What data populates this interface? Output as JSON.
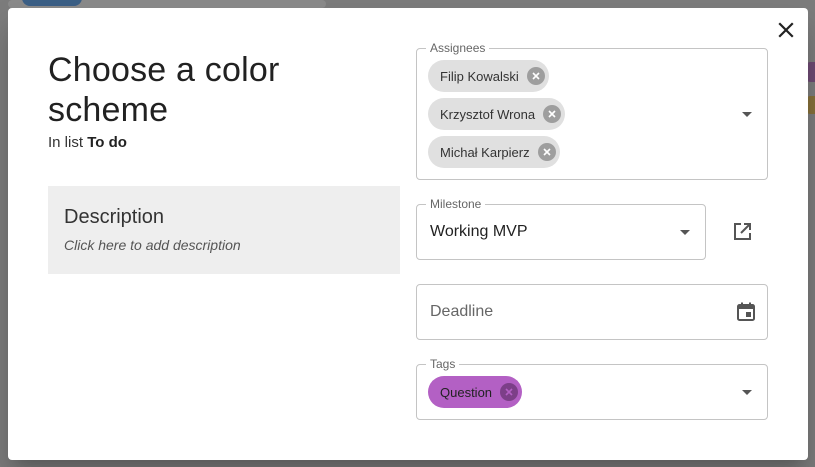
{
  "dialog": {
    "title": "Choose a color scheme",
    "subtitle_prefix": "In list",
    "list_name": "To do",
    "description": {
      "heading": "Description",
      "hint": "Click here to add description"
    },
    "assignees": {
      "label": "Assignees",
      "chips": [
        "Filip Kowalski",
        "Krzysztof Wrona",
        "Michał Karpierz"
      ]
    },
    "milestone": {
      "label": "Milestone",
      "value": "Working MVP"
    },
    "deadline": {
      "placeholder": "Deadline"
    },
    "tags": {
      "label": "Tags",
      "chips": [
        "Question"
      ]
    }
  },
  "colors": {
    "tag_question": "#b360c4",
    "chip_default": "#e0e0e0",
    "overlay": "#7a7a7a"
  },
  "icons": {
    "close": "close-icon",
    "open_milestone": "open-in-new-icon",
    "calendar": "calendar-icon",
    "dropdown": "arrow-drop-down-icon",
    "chip_remove": "cancel-icon"
  }
}
